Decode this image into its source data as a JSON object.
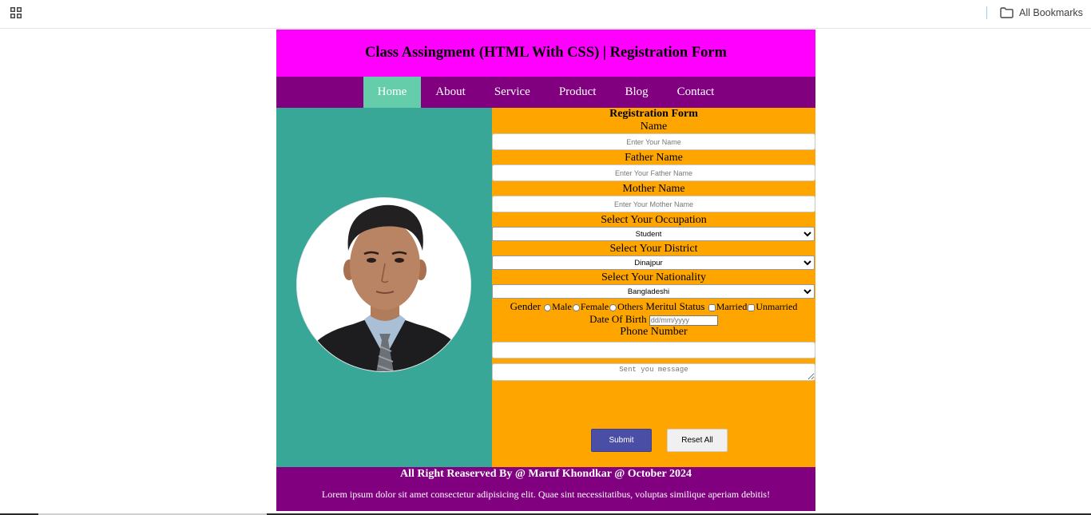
{
  "browser": {
    "bookmarks_label": "All Bookmarks"
  },
  "header": {
    "title": "Class Assingment (HTML With CSS) | Registration Form"
  },
  "nav": {
    "items": [
      "Home",
      "About",
      "Service",
      "Product",
      "Blog",
      "Contact"
    ]
  },
  "form": {
    "title": "Registration Form",
    "name_label": "Name",
    "name_placeholder": "Enter Your Name",
    "father_label": "Father Name",
    "father_placeholder": "Enter Your Father Name",
    "mother_label": "Mother Name",
    "mother_placeholder": "Enter Your Mother Name",
    "occupation_label": "Select Your Occupation",
    "occupation_value": "Student",
    "district_label": "Select Your District",
    "district_value": "Dinajpur",
    "nationality_label": "Select Your Nationality",
    "nationality_value": "Bangladeshi",
    "gender_label": "Gender",
    "gender_options": [
      "Male",
      "Female",
      "Others"
    ],
    "marital_label": "Meritul Status",
    "marital_options": [
      "Married",
      "Unmarried"
    ],
    "dob_label": "Date Of Birth",
    "dob_placeholder": "dd/mm/yyyy",
    "phone_label": "Phone Number",
    "message_placeholder": "Sent you message",
    "submit_label": "Submit",
    "reset_label": "Reset All"
  },
  "footer": {
    "line1": "All Right Reaserved By @ Maruf Khondkar @ October 2024",
    "line2": "Lorem ipsum dolor sit amet consectetur adipisicing elit. Quae sint necessitatibus, voluptas similique aperiam debitis!"
  },
  "colors": {
    "header_bg": "#ff00ff",
    "nav_bg": "#800080",
    "nav_active": "#66cdaa",
    "left_panel": "#38a797",
    "form_bg": "#ffa500",
    "footer_bg": "#800080",
    "submit_bg": "#4a4fa5"
  },
  "icons": {
    "apps": "apps-grid-icon",
    "bookmarks": "folder-icon",
    "profile": "profile-photo"
  }
}
